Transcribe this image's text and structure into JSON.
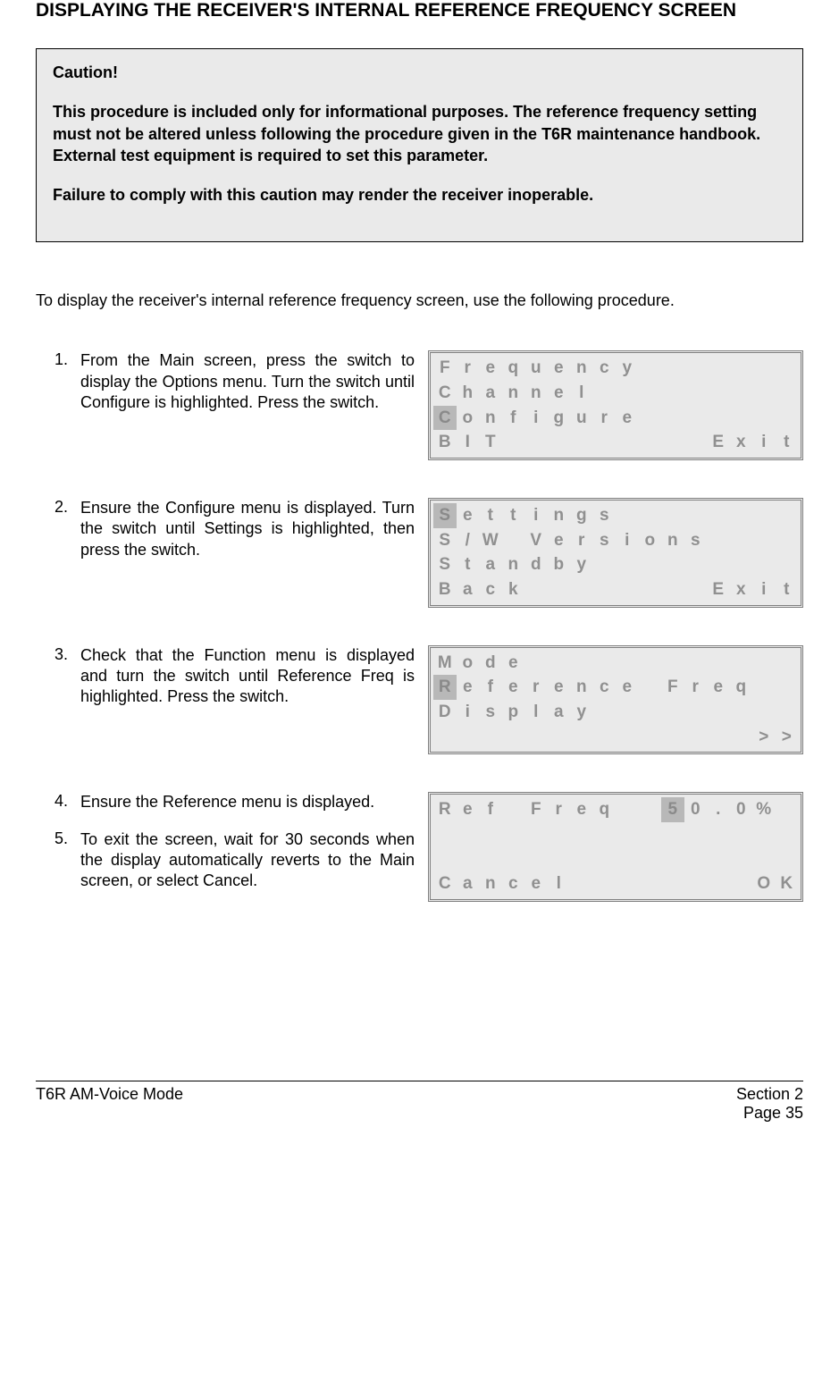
{
  "title": "DISPLAYING THE RECEIVER'S INTERNAL REFERENCE FREQUENCY SCREEN",
  "caution": {
    "heading": "Caution!",
    "body": "This procedure is included only for informational purposes. The reference frequency setting must not be altered unless following the procedure given in the T6R maintenance handbook. External test equipment is required to set this parameter.",
    "warn": "Failure to comply with this caution may render the receiver inoperable."
  },
  "intro": "To display the receiver's internal reference frequency screen, use the following procedure.",
  "steps": {
    "s1": {
      "num": "1.",
      "text": "From the Main screen, press the switch to display the Options menu. Turn the switch until Configure is highlighted. Press the switch."
    },
    "s2": {
      "num": "2.",
      "text": "Ensure the Configure menu is displayed. Turn the switch until Settings is highlighted, then press the switch."
    },
    "s3": {
      "num": "3.",
      "text": "Check that the Function menu is displayed and  turn the switch until Reference Freq is highlighted. Press the switch."
    },
    "s4": {
      "num": "4.",
      "text": "Ensure the Reference menu is displayed."
    },
    "s5": {
      "num": "5.",
      "text": "To exit the screen, wait for 30 seconds when the display automatically reverts to the Main screen, or select Cancel."
    }
  },
  "lcd1": {
    "rows": [
      {
        "cells": [
          "F",
          "r",
          "e",
          "q",
          "u",
          "e",
          "n",
          "c",
          "y",
          "",
          "",
          "",
          "",
          "",
          "",
          ""
        ],
        "hl": []
      },
      {
        "cells": [
          "C",
          "h",
          "a",
          "n",
          "n",
          "e",
          "l",
          "",
          "",
          "",
          "",
          "",
          "",
          "",
          "",
          ""
        ],
        "hl": []
      },
      {
        "cells": [
          "C",
          "o",
          "n",
          "f",
          "i",
          "g",
          "u",
          "r",
          "e",
          "",
          "",
          "",
          "",
          "",
          "",
          ""
        ],
        "hl": [
          0
        ]
      },
      {
        "cells": [
          "B",
          "I",
          "T",
          "",
          "",
          "",
          "",
          "",
          "",
          "",
          "",
          "",
          "E",
          "x",
          "i",
          "t"
        ],
        "hl": []
      }
    ]
  },
  "lcd2": {
    "rows": [
      {
        "cells": [
          "S",
          "e",
          "t",
          "t",
          "i",
          "n",
          "g",
          "s",
          "",
          "",
          "",
          "",
          "",
          "",
          "",
          ""
        ],
        "hl": [
          0
        ]
      },
      {
        "cells": [
          "S",
          "/",
          "W",
          "",
          "V",
          "e",
          "r",
          "s",
          "i",
          "o",
          "n",
          "s",
          "",
          "",
          "",
          ""
        ],
        "hl": []
      },
      {
        "cells": [
          "S",
          "t",
          "a",
          "n",
          "d",
          "b",
          "y",
          "",
          "",
          "",
          "",
          "",
          "",
          "",
          "",
          ""
        ],
        "hl": []
      },
      {
        "cells": [
          "B",
          "a",
          "c",
          "k",
          "",
          "",
          "",
          "",
          "",
          "",
          "",
          "",
          "E",
          "x",
          "i",
          "t"
        ],
        "hl": []
      }
    ]
  },
  "lcd3": {
    "rows": [
      {
        "cells": [
          "M",
          "o",
          "d",
          "e",
          "",
          "",
          "",
          "",
          "",
          "",
          "",
          "",
          "",
          "",
          "",
          ""
        ],
        "hl": []
      },
      {
        "cells": [
          "R",
          "e",
          "f",
          "e",
          "r",
          "e",
          "n",
          "c",
          "e",
          "",
          "F",
          "r",
          "e",
          "q",
          "",
          ""
        ],
        "hl": [
          0
        ]
      },
      {
        "cells": [
          "D",
          "i",
          "s",
          "p",
          "l",
          "a",
          "y",
          "",
          "",
          "",
          "",
          "",
          "",
          "",
          "",
          ""
        ],
        "hl": []
      },
      {
        "cells": [
          "",
          "",
          "",
          "",
          "",
          "",
          "",
          "",
          "",
          "",
          "",
          "",
          "",
          "",
          ">",
          ">"
        ],
        "hl": []
      }
    ]
  },
  "lcd4": {
    "rows": [
      {
        "cells": [
          "R",
          "e",
          "f",
          "",
          "F",
          "r",
          "e",
          "q",
          "",
          "",
          "5",
          "0",
          ".",
          "0",
          "%",
          ""
        ],
        "hl": [
          10
        ]
      },
      {
        "cells": [
          "",
          "",
          "",
          "",
          "",
          "",
          "",
          "",
          "",
          "",
          "",
          "",
          "",
          "",
          "",
          ""
        ],
        "hl": []
      },
      {
        "cells": [
          "",
          "",
          "",
          "",
          "",
          "",
          "",
          "",
          "",
          "",
          "",
          "",
          "",
          "",
          "",
          ""
        ],
        "hl": []
      },
      {
        "cells": [
          "C",
          "a",
          "n",
          "c",
          "e",
          "l",
          "",
          "",
          "",
          "",
          "",
          "",
          "",
          "",
          "O",
          "K"
        ],
        "hl": []
      }
    ]
  },
  "footer": {
    "left": "T6R AM-Voice Mode",
    "right_top": "Section 2",
    "right_bottom": "Page 35"
  }
}
